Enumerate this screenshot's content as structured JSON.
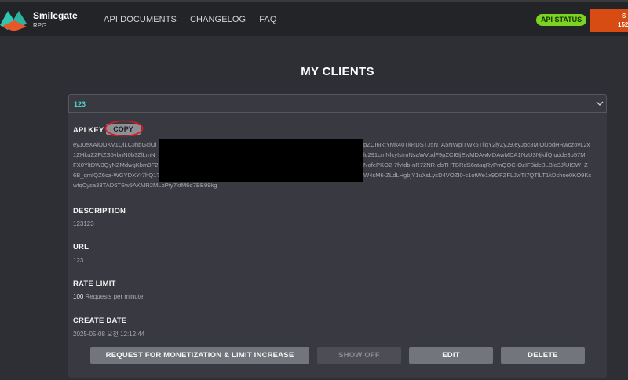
{
  "header": {
    "brand_name": "Smilegate",
    "brand_sub": "RPG",
    "nav": [
      "API DOCUMENTS",
      "CHANGELOG",
      "FAQ"
    ],
    "api_status": "API STATUS",
    "orange_line1": "S",
    "orange_line2": "152",
    "colors": {
      "logo_teal": "#31c4b0",
      "logo_orange": "#e8572a",
      "status_green": "#7dd321",
      "orange": "#d64c12"
    }
  },
  "page_title": "MY CLIENTS",
  "client": {
    "name": "123",
    "api_key_label": "API KEY",
    "copy_label": "COPY",
    "api_key_lines": [
      "eyJ0eXAiOiJKV1QiLCJhbGciOi",
      "1ZHkuZ2FtZS5vbnN0b3ZlLmN",
      "FX0YltDW3QyNZMdwgKbm3F2",
      "6B_qmIQZ6ca-WGYDXYr7hQ1?",
      "wtqCysa33TAD6TSw5AKMR2MLbPty7ktM6d7BB99kg"
    ],
    "api_key_lines_right": [
      "pZCI6IktYMk40TkRDSTJ5NTA5NWpjTWk5TllqY2lyZyJ9.eyJpc3MiOiJodHRwczovL2x",
      "lc291cmNlcyIsImNsaWVudF9pZCI6IjEwMDAwMDAwMDA1NzU3NjkifQ.qdde3b57M",
      "NofePKO2-7fyfdb-nR72NR-ebTHTBRdS6ntaqRyPmQQC-OzIF0idcBLBle3JfUISW_Z",
      "W4sM6-ZLdLHgbjY1uXsLysD4VOZI0-c1otWe1x9OFZFLJwTI7QTlLT1kDchoe0KO9Kc"
    ],
    "description_label": "DESCRIPTION",
    "description": "123123",
    "url_label": "URL",
    "url": "123",
    "rate_label": "RATE LIMIT",
    "rate_value": "100",
    "rate_unit": " Requests per minute",
    "created_label": "CREATE DATE",
    "created": "2025-05-08 오전 12:12:44",
    "buttons": {
      "monetize": "REQUEST FOR MONETIZATION & LIMIT INCREASE",
      "show_off": "SHOW OFF",
      "edit": "EDIT",
      "delete": "DELETE"
    }
  }
}
